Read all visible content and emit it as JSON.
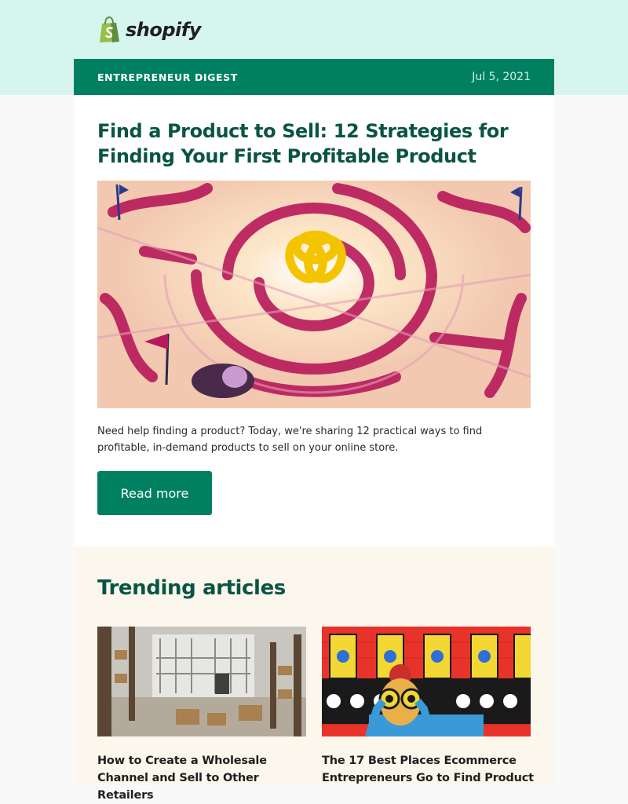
{
  "brand": {
    "name": "shopify",
    "logo_icon": "shopping-bag-icon",
    "accent": "#008060",
    "header_bg": "#d6f5ef"
  },
  "digest": {
    "label": "ENTREPRENEUR DIGEST",
    "date": "Jul 5, 2021"
  },
  "feature": {
    "title": "Find a Product to Sell: 12 Strategies for Finding Your First Profitable Product",
    "image": "maze-illustration",
    "summary": "Need help finding a product? Today, we're sharing 12 practical ways to find profitable, in-demand products to sell on your online store.",
    "cta_label": "Read more"
  },
  "trending": {
    "heading": "Trending articles",
    "articles": [
      {
        "title": "How to Create a Wholesale Channel and Sell to Other Retailers",
        "image": "warehouse-photo"
      },
      {
        "title": "The 17 Best Places Ecommerce Entrepreneurs Go to Find Product",
        "image": "conveyor-binoculars-illustration"
      }
    ]
  }
}
